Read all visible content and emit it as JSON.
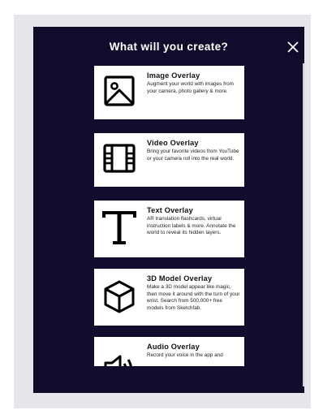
{
  "modal": {
    "title": "What will you create?"
  },
  "cards": [
    {
      "name": "Image Overlay",
      "description": "Augment your world with images from your camera, photo gallery & more.",
      "icon": "image-icon"
    },
    {
      "name": "Video Overlay",
      "description": "Bring your favorite videos from YouTube or your camera roll into the real world.",
      "icon": "film-icon"
    },
    {
      "name": "Text Overlay",
      "description": "AR translation flashcards, virtual instruction labels & more. Annotate the world to reveal its hidden layers.",
      "icon": "text-t-icon"
    },
    {
      "name": "3D Model Overlay",
      "description": "Make a 3D model appear like magic, then move it around with the turn of your wrist. Search from 500,000+ free models from Sketchfab.",
      "icon": "cube-icon"
    },
    {
      "name": "Audio Overlay",
      "description": "Record your voice in the app and",
      "icon": "speaker-icon"
    }
  ],
  "colors": {
    "modal_bg": "#0f0d2b",
    "card_bg": "#ffffff",
    "frame_bg": "#e6e7ea"
  }
}
